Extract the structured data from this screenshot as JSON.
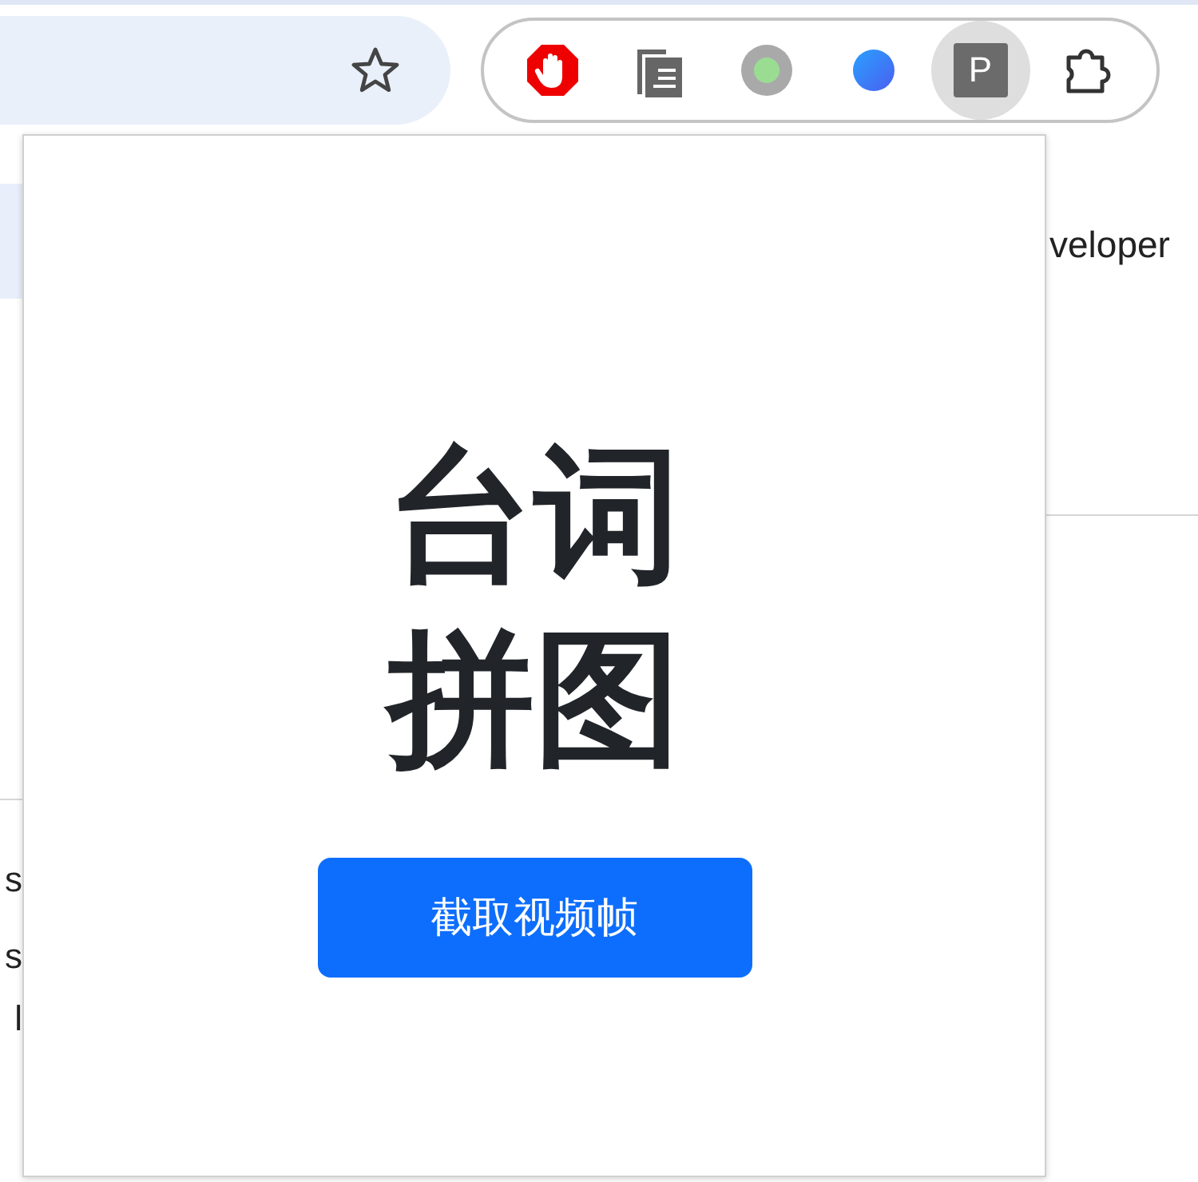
{
  "toolbar": {
    "extensions": [
      {
        "kind": "stop-hand",
        "selected": false
      },
      {
        "kind": "documents",
        "selected": false
      },
      {
        "kind": "ring-dot",
        "selected": false
      },
      {
        "kind": "blue-dot",
        "selected": false
      },
      {
        "kind": "letter",
        "label": "P",
        "selected": true
      },
      {
        "kind": "puzzle",
        "selected": false
      }
    ]
  },
  "background_page": {
    "right_text": "veloper",
    "left_texts": [
      "s",
      "s",
      "l"
    ]
  },
  "popup": {
    "title_lines": [
      "台词",
      "拼图"
    ],
    "button": "截取视频帧"
  }
}
